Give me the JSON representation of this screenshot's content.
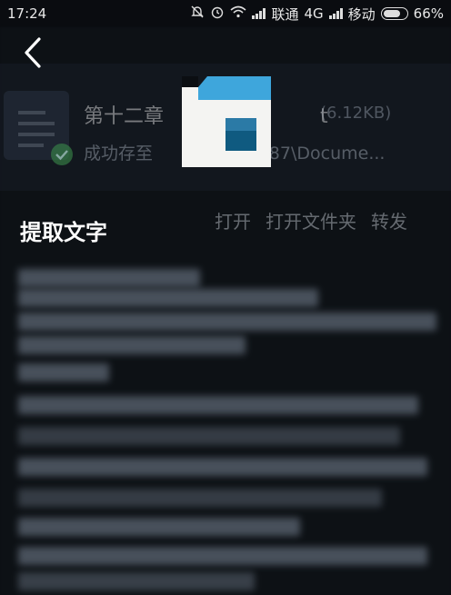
{
  "status_bar": {
    "time": "17:24",
    "carrier1": "联通",
    "network": "4G",
    "carrier2": "移动",
    "battery": "66%",
    "battery_level": 0.66
  },
  "background_sheet": {
    "file_title": "第十二章",
    "file_title_suffix": "t",
    "file_size": "(6.12KB)",
    "save_status_prefix": "成功存至",
    "save_path_tail": "e087\\Docume...",
    "actions": [
      "打开",
      "打开文件夹",
      "转发"
    ]
  },
  "nav": {
    "back_icon": "chevron-left-icon"
  },
  "section": {
    "title": "提取文字"
  },
  "colors": {
    "background": "#0b0e12",
    "logo_blue": "#3ea6dc",
    "logo_dark": "#0f5a80",
    "logo_white": "#f4f4f2"
  }
}
